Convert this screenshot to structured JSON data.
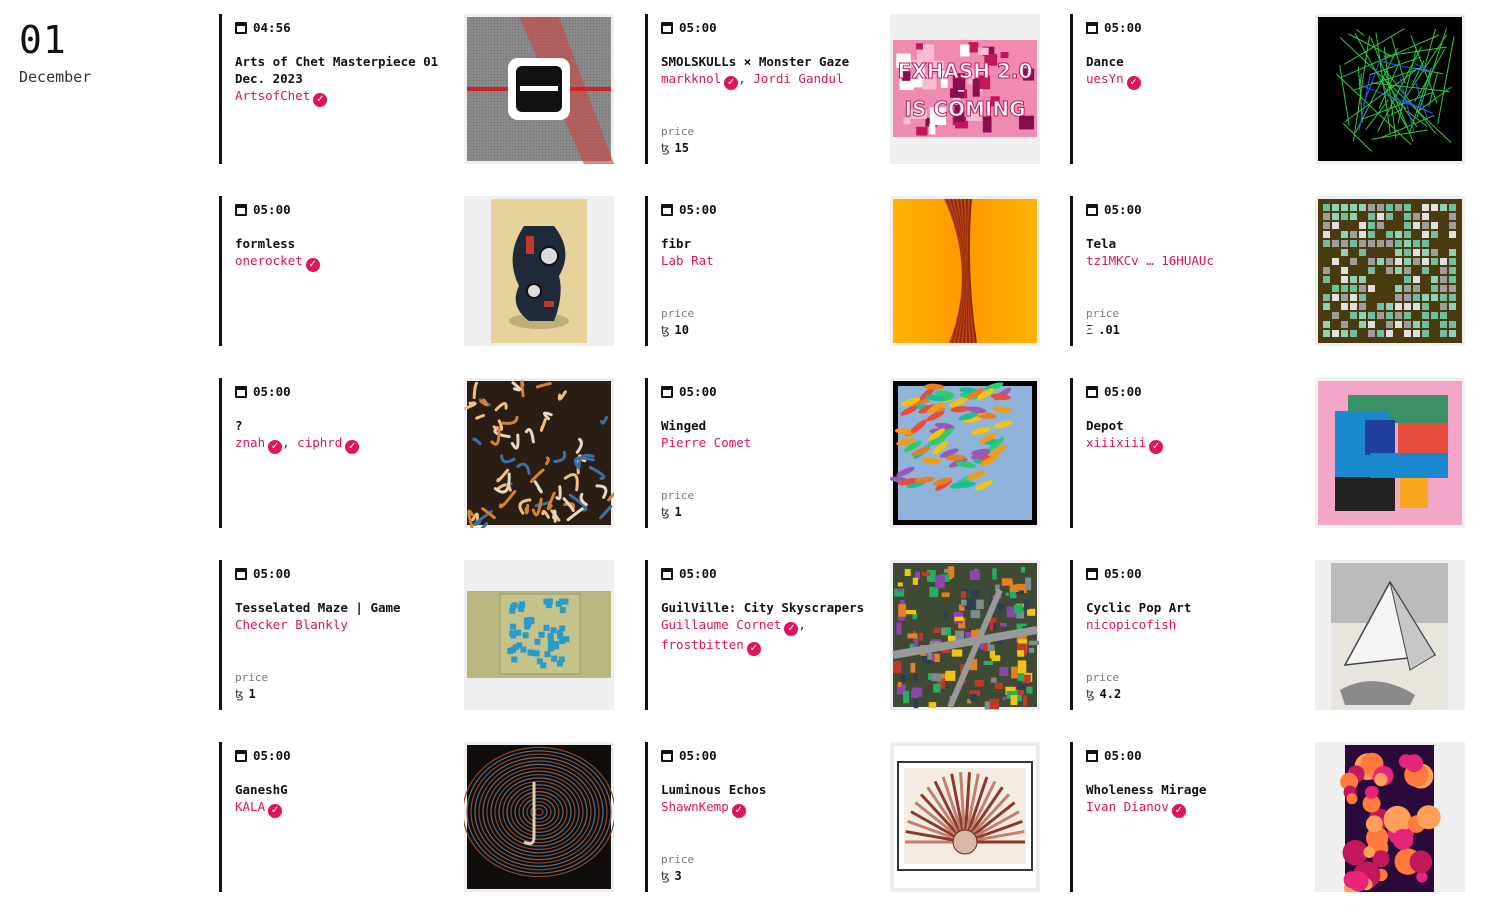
{
  "date": {
    "day": "01",
    "month": "December"
  },
  "currency": {
    "tez": "ꜩ",
    "eth": "Ξ"
  },
  "cards": [
    {
      "time": "04:56",
      "title": "Arts of Chet Masterpiece 01 Dec. 2023",
      "authors": [
        {
          "name": "ArtsofChet",
          "verified": true
        }
      ],
      "price": null,
      "art": "grey-bar-logo"
    },
    {
      "time": "05:00",
      "title": "SMOLSKULLs × Monster Gaze",
      "authors": [
        {
          "name": "markknol",
          "verified": true
        },
        {
          "name": "Jordi Gandul",
          "verified": false
        }
      ],
      "price": {
        "label": "price",
        "currency": "tez",
        "value": "15"
      },
      "art": "pink-fxhash-banner",
      "art_text": "FXHASH 2.0 IS COMING"
    },
    {
      "time": "05:00",
      "title": "Dance",
      "authors": [
        {
          "name": "uesYn",
          "verified": true
        }
      ],
      "price": null,
      "art": "green-lines-on-black"
    },
    {
      "time": "05:00",
      "title": "formless",
      "authors": [
        {
          "name": "onerocket",
          "verified": true
        }
      ],
      "price": null,
      "art": "beige-abstract-figure"
    },
    {
      "time": "05:00",
      "title": "fibr",
      "authors": [
        {
          "name": "Lab Rat",
          "verified": false
        }
      ],
      "price": {
        "label": "price",
        "currency": "tez",
        "value": "10"
      },
      "art": "orange-twisted-fiber"
    },
    {
      "time": "05:00",
      "title": "Tela",
      "authors": [
        {
          "name": "tz1MKCv … 16HUAUc",
          "verified": false
        }
      ],
      "price": {
        "label": "price",
        "currency": "eth",
        "value": ".01"
      },
      "art": "green-tile-grid"
    },
    {
      "time": "05:00",
      "title": "?",
      "authors": [
        {
          "name": "znah",
          "verified": true
        },
        {
          "name": "ciphrd",
          "verified": true
        }
      ],
      "price": null,
      "art": "swirl-texture"
    },
    {
      "time": "05:00",
      "title": "Winged",
      "authors": [
        {
          "name": "Pierre Comet",
          "verified": false
        }
      ],
      "price": {
        "label": "price",
        "currency": "tez",
        "value": "1"
      },
      "art": "feathered-color-fan"
    },
    {
      "time": "05:00",
      "title": "Depot",
      "authors": [
        {
          "name": "xiiixiii",
          "verified": true
        }
      ],
      "price": null,
      "art": "geometric-blocks-pink"
    },
    {
      "time": "05:00",
      "title": "Tesselated Maze | Game",
      "authors": [
        {
          "name": "Checker Blankly",
          "verified": false
        }
      ],
      "price": {
        "label": "price",
        "currency": "tez",
        "value": "1"
      },
      "art": "olive-maze"
    },
    {
      "time": "05:00",
      "title": "GuilVille: City Skyscrapers",
      "authors": [
        {
          "name": "Guillaume Cornet",
          "verified": true
        },
        {
          "name": "frostbitten",
          "verified": true
        }
      ],
      "price": null,
      "art": "pixel-city"
    },
    {
      "time": "05:00",
      "title": "Cyclic Pop Art",
      "authors": [
        {
          "name": "nicopicofish",
          "verified": false
        }
      ],
      "price": {
        "label": "price",
        "currency": "tez",
        "value": "4.2"
      },
      "art": "pyramid-sketch"
    },
    {
      "time": "05:00",
      "title": "GaneshG",
      "authors": [
        {
          "name": "KALA",
          "verified": true
        }
      ],
      "price": null,
      "art": "dark-concentric-rings"
    },
    {
      "time": "05:00",
      "title": "Luminous Echos",
      "authors": [
        {
          "name": "ShawnKemp",
          "verified": true
        }
      ],
      "price": {
        "label": "price",
        "currency": "tez",
        "value": "3"
      },
      "art": "framed-ink-rays"
    },
    {
      "time": "05:00",
      "title": "Wholeness Mirage",
      "authors": [
        {
          "name": "Ivan Dianov",
          "verified": true
        }
      ],
      "price": null,
      "art": "magenta-blobs"
    }
  ]
}
